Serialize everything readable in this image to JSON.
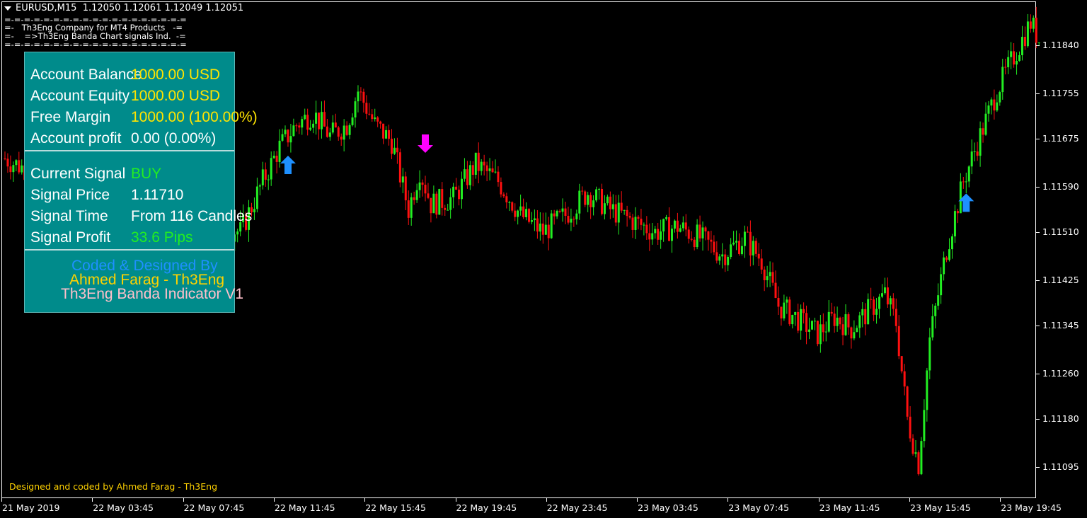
{
  "header": {
    "symbol_line": "EURUSD,M15  1.12050 1.12061 1.12049 1.12051",
    "banner_top": "=-=-=-=-=-=-=-=-=-=-=-=-=-=-=-=-=-=-=",
    "banner_line1": "=-   Th3Eng Company for MT4 Products   -=",
    "banner_line2": "=-    =>Th3Eng Banda Chart signals Ind.  -=",
    "banner_bottom": "=-=-=-=-=-=-=-=-=-=-=-=-=-=-=-=-=-=-="
  },
  "panel": {
    "account_balance_label": "Account Balance",
    "account_balance_value": "1000.00 USD",
    "account_equity_label": "Account Equity",
    "account_equity_value": "1000.00 USD",
    "free_margin_label": "Free Margin",
    "free_margin_value": "1000.00  (100.00%)",
    "account_profit_label": "Account profit",
    "account_profit_value": "0.00  (0.00%)",
    "current_signal_label": "Current Signal",
    "current_signal_value": "BUY",
    "signal_price_label": "Signal Price",
    "signal_price_value": "1.11710",
    "signal_time_label": "Signal Time",
    "signal_time_value": "From 116 Candles",
    "signal_profit_label": "Signal Profit",
    "signal_profit_value": "33.6  Pips",
    "credit_line1": "Coded & Designed By",
    "credit_line2": "Ahmed Farag - Th3Eng",
    "credit_line3": "Th3Eng Banda Indicator V1"
  },
  "footer": "Designed and coded by Ahmed Farag - Th3Eng",
  "colors": {
    "background": "#000000",
    "bull": "#22ee22",
    "bear": "#ff1010",
    "buy_arrow": "#1e90ff",
    "sell_arrow": "#ff00ff",
    "panel": "#008b8b"
  },
  "chart_data": {
    "type": "candlestick",
    "symbol": "EURUSD",
    "timeframe": "M15",
    "ylim": [
      1.1104,
      1.1192
    ],
    "y_ticks": [
      "1.11840",
      "1.11755",
      "1.11675",
      "1.11590",
      "1.11510",
      "1.11425",
      "1.11345",
      "1.11260",
      "1.11180",
      "1.11095"
    ],
    "x_ticks": [
      "21 May 2019",
      "22 May 03:45",
      "22 May 07:45",
      "22 May 11:45",
      "22 May 15:45",
      "22 May 19:45",
      "22 May 23:45",
      "23 May 03:45",
      "23 May 07:45",
      "23 May 11:45",
      "23 May 15:45",
      "23 May 19:45"
    ],
    "signals": [
      {
        "type": "buy",
        "candle": 101
      },
      {
        "type": "sell",
        "candle": 150
      },
      {
        "type": "buy",
        "candle": 343
      }
    ],
    "close_path": [
      [
        0,
        1.1164
      ],
      [
        12,
        1.1161
      ],
      [
        30,
        1.1158
      ],
      [
        50,
        1.1156
      ],
      [
        70,
        1.1153
      ],
      [
        84,
        1.1151
      ],
      [
        92,
        1.116
      ],
      [
        98,
        1.1166
      ],
      [
        104,
        1.117
      ],
      [
        110,
        1.1172
      ],
      [
        116,
        1.1168
      ],
      [
        122,
        1.117
      ],
      [
        126,
        1.1176
      ],
      [
        132,
        1.117
      ],
      [
        138,
        1.1167
      ],
      [
        144,
        1.1155
      ],
      [
        148,
        1.1162
      ],
      [
        152,
        1.1156
      ],
      [
        160,
        1.1157
      ],
      [
        168,
        1.1163
      ],
      [
        176,
        1.116
      ],
      [
        184,
        1.1154
      ],
      [
        192,
        1.1151
      ],
      [
        200,
        1.1154
      ],
      [
        208,
        1.1158
      ],
      [
        216,
        1.1155
      ],
      [
        224,
        1.1153
      ],
      [
        232,
        1.1151
      ],
      [
        240,
        1.1152
      ],
      [
        248,
        1.115
      ],
      [
        256,
        1.1147
      ],
      [
        264,
        1.115
      ],
      [
        270,
        1.1146
      ],
      [
        276,
        1.1138
      ],
      [
        282,
        1.1136
      ],
      [
        290,
        1.1133
      ],
      [
        296,
        1.1136
      ],
      [
        302,
        1.1134
      ],
      [
        308,
        1.1137
      ],
      [
        314,
        1.114
      ],
      [
        318,
        1.1135
      ],
      [
        322,
        1.1118
      ],
      [
        326,
        1.111
      ],
      [
        330,
        1.1132
      ],
      [
        336,
        1.1148
      ],
      [
        342,
        1.116
      ],
      [
        348,
        1.1168
      ],
      [
        354,
        1.1176
      ],
      [
        360,
        1.1182
      ],
      [
        366,
        1.1188
      ],
      [
        369,
        1.1185
      ]
    ]
  }
}
